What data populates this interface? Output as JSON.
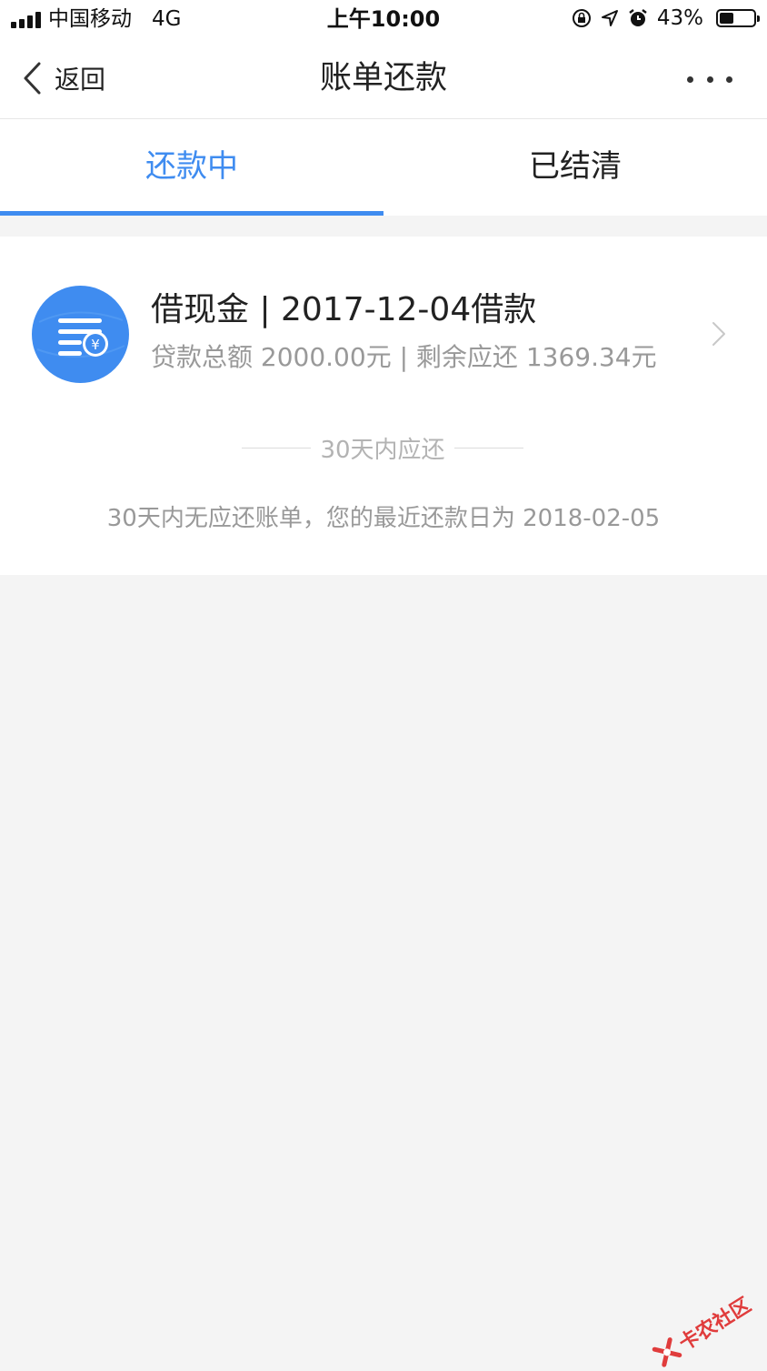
{
  "status_bar": {
    "carrier": "中国移动",
    "network": "4G",
    "time": "上午10:00",
    "battery_percent": "43%",
    "battery_level": 0.43,
    "icons": [
      "orientation-lock-icon",
      "location-arrow-icon",
      "alarm-icon"
    ]
  },
  "nav": {
    "back_label": "返回",
    "title": "账单还款",
    "more_icon": "more-dots-icon"
  },
  "tabs": [
    {
      "label": "还款中",
      "active": true
    },
    {
      "label": "已结清",
      "active": false
    }
  ],
  "loan": {
    "title": "借现金 | 2017-12-04借款",
    "subtitle": "贷款总额 2000.00元 | 剩余应还 1369.34元",
    "icon": "bill-yuan-icon"
  },
  "section": {
    "label": "30天内应还",
    "notice": "30天内无应还账单，您的最近还款日为 2018-02-05"
  },
  "watermark": {
    "text": "卡农社区"
  },
  "colors": {
    "accent": "#3f8cf0",
    "background": "#f4f4f4"
  }
}
